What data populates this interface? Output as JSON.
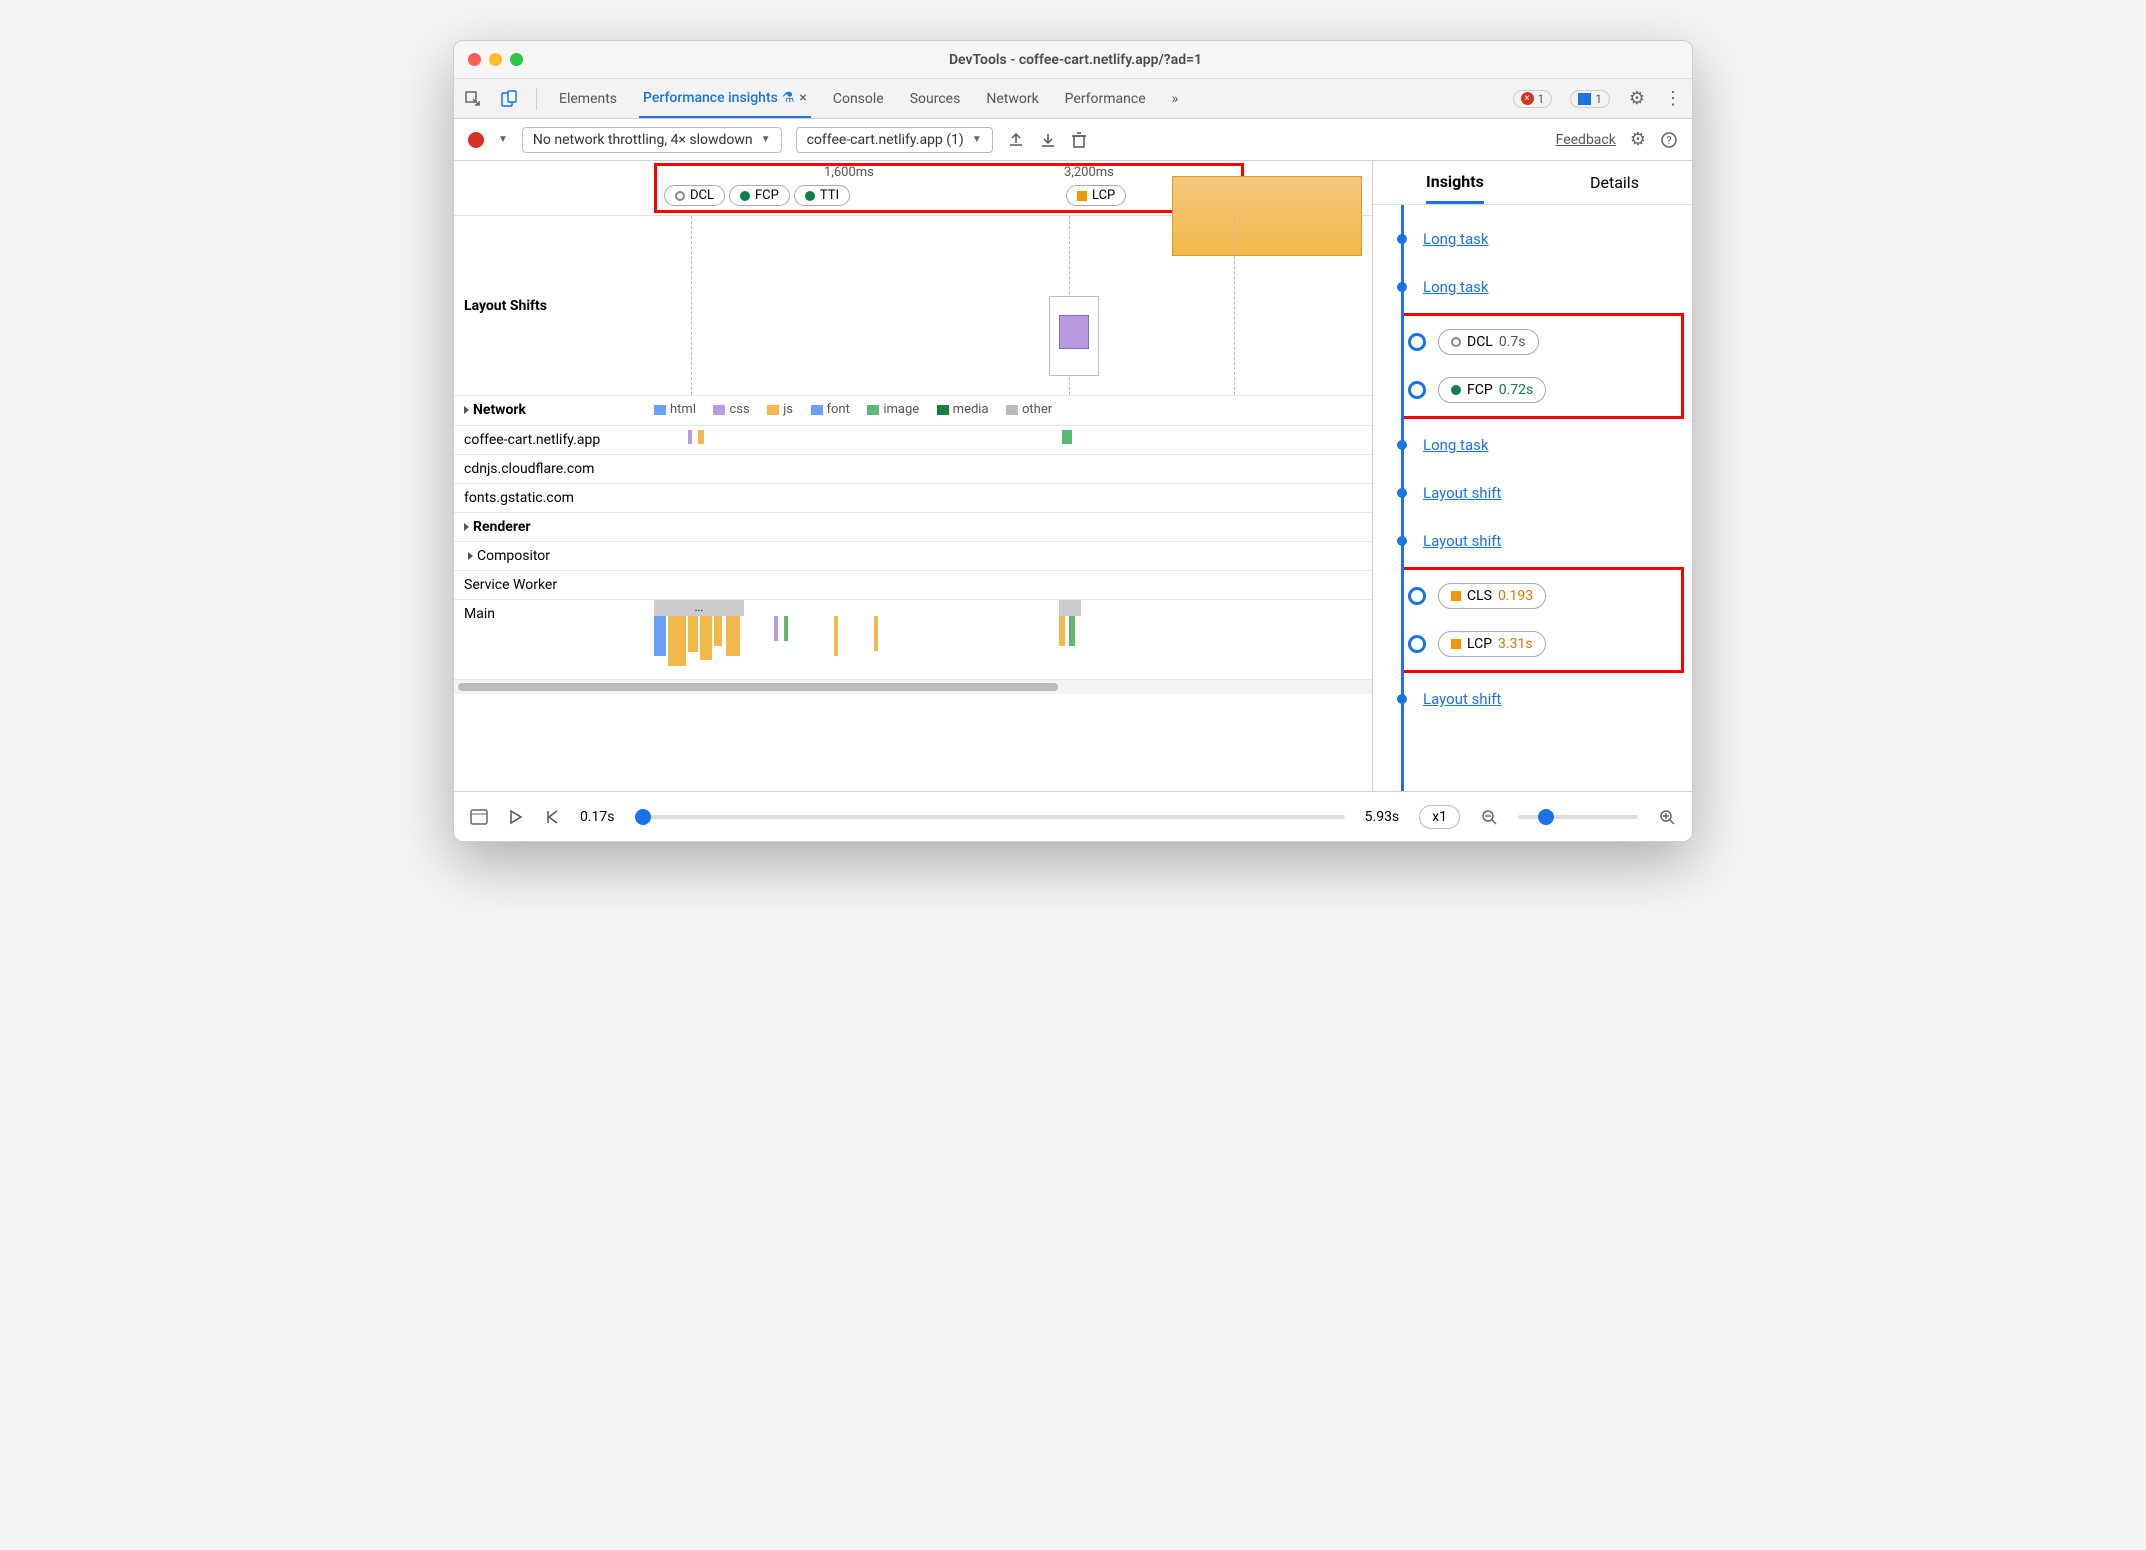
{
  "window_title": "DevTools - coffee-cart.netlify.app/?ad=1",
  "tabs": {
    "elements": "Elements",
    "perf_insights": "Performance insights",
    "console": "Console",
    "sources": "Sources",
    "network": "Network",
    "performance": "Performance",
    "more": "»",
    "error_count": "1",
    "msg_count": "1"
  },
  "toolbar": {
    "throttle": "No network throttling, 4× slowdown",
    "session": "coffee-cart.netlify.app (1)",
    "feedback": "Feedback"
  },
  "timeline": {
    "t1": "1,600ms",
    "t2": "3,200ms",
    "dcl": "DCL",
    "fcp": "FCP",
    "tti": "TTI",
    "lcp": "LCP"
  },
  "rows": {
    "layout_shifts": "Layout Shifts",
    "network": "Network",
    "net_hosts": [
      "coffee-cart.netlify.app",
      "cdnjs.cloudflare.com",
      "fonts.gstatic.com"
    ],
    "renderer": "Renderer",
    "compositor": "Compositor",
    "service_worker": "Service Worker",
    "main": "Main"
  },
  "legend": {
    "html": "html",
    "css": "css",
    "js": "js",
    "font": "font",
    "image": "image",
    "media": "media",
    "other": "other"
  },
  "right": {
    "tab_insights": "Insights",
    "tab_details": "Details",
    "items": [
      {
        "type": "link",
        "text": "Long task"
      },
      {
        "type": "link",
        "text": "Long task"
      },
      {
        "type": "pill",
        "icon": "circle-outline",
        "iconColor": "#666",
        "label": "DCL",
        "val": "0.7s",
        "valColor": "#555"
      },
      {
        "type": "pill",
        "icon": "circle",
        "iconColor": "#0b8043",
        "label": "FCP",
        "val": "0.72s",
        "valColor": "#0b8043"
      },
      {
        "type": "link",
        "text": "Long task"
      },
      {
        "type": "link",
        "text": "Layout shift"
      },
      {
        "type": "link",
        "text": "Layout shift"
      },
      {
        "type": "pill",
        "icon": "square",
        "iconColor": "#f29900",
        "label": "CLS",
        "val": "0.193",
        "valColor": "#e8710a"
      },
      {
        "type": "pill",
        "icon": "square",
        "iconColor": "#f29900",
        "label": "LCP",
        "val": "3.31s",
        "valColor": "#e8710a"
      },
      {
        "type": "link",
        "text": "Layout shift"
      }
    ]
  },
  "player": {
    "start": "0.17s",
    "end": "5.93s",
    "speed": "x1"
  }
}
